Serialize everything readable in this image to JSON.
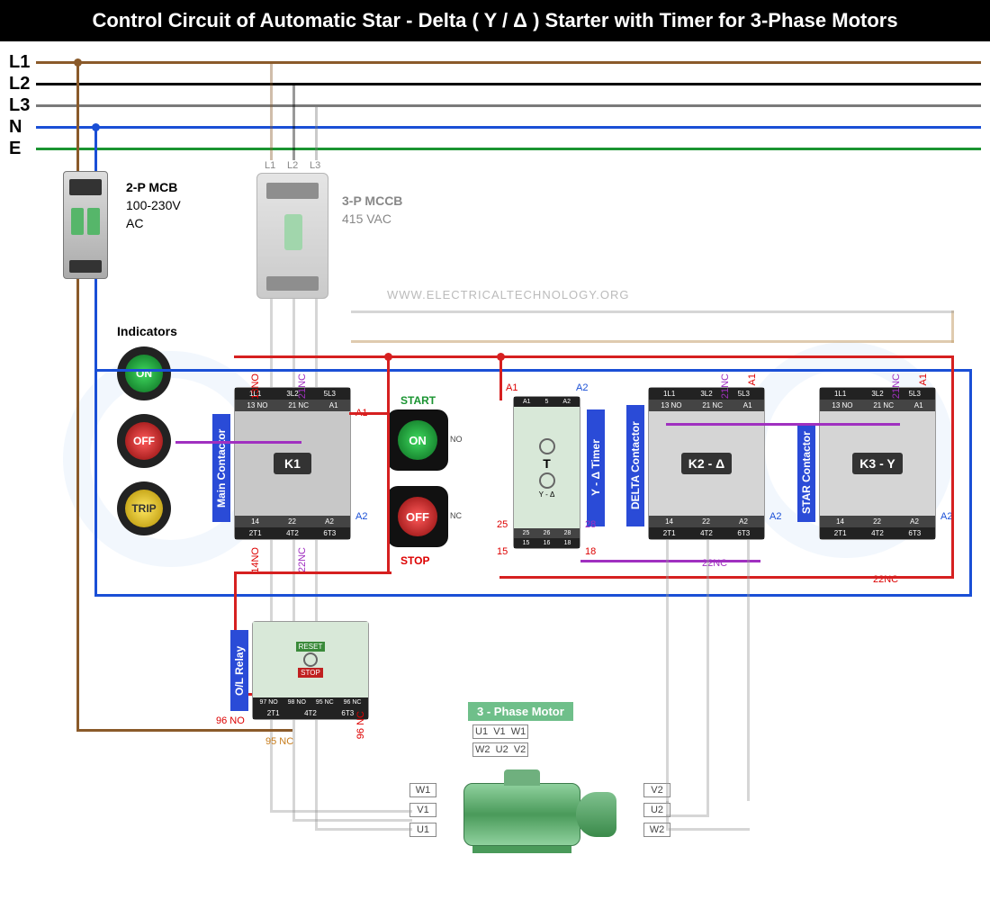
{
  "title": "Control Circuit of Automatic Star - Delta ( Y / Δ ) Starter with Timer for 3-Phase Motors",
  "website": "WWW.ELECTRICALTECHNOLOGY.ORG",
  "bus": {
    "L1": {
      "label": "L1",
      "color": "#8a5a2a"
    },
    "L2": {
      "label": "L2",
      "color": "#000000"
    },
    "L3": {
      "label": "L3",
      "color": "#7a7a7a"
    },
    "N": {
      "label": "N",
      "color": "#1a4fd6"
    },
    "E": {
      "label": "E",
      "color": "#1a9431"
    }
  },
  "mcb": {
    "label": "2-P MCB",
    "voltage": "100-230V",
    "type": "AC"
  },
  "mccb": {
    "label": "3-P MCCB",
    "voltage": "415 VAC",
    "terms": [
      "L1",
      "L2",
      "L3"
    ]
  },
  "indicators": {
    "heading": "Indicators",
    "on": {
      "label": "ON",
      "color": "#1a9431"
    },
    "off": {
      "label": "OFF",
      "color": "#d62020"
    },
    "trip": {
      "label": "TRIP",
      "color": "#e8c820"
    }
  },
  "pushbuttons": {
    "start": {
      "label": "ON",
      "heading": "START",
      "color": "#1a9431"
    },
    "stop": {
      "label": "OFF",
      "heading": "STOP",
      "color": "#d62020"
    }
  },
  "contactors": {
    "main": {
      "name": "K1",
      "label": "Main Contactor",
      "top": [
        "1L1",
        "3L2",
        "5L3"
      ],
      "aux_top": [
        "13 NO",
        "21 NC",
        "A1"
      ],
      "aux_bot": [
        "14",
        "14 NO",
        "22",
        "22 NC",
        "A2"
      ],
      "bot": [
        "2T1",
        "4T2",
        "6T3"
      ]
    },
    "delta": {
      "name": "K2 - Δ",
      "label": "DELTA Contactor",
      "top": [
        "1L1",
        "3L2",
        "5L3"
      ],
      "aux_top": [
        "13 NO",
        "21 NC",
        "A1"
      ],
      "aux_bot": [
        "14",
        "22",
        "A2"
      ],
      "bot": [
        "2T1",
        "4T2",
        "6T3"
      ]
    },
    "star": {
      "name": "K3 - Y",
      "label": "STAR Contactor",
      "top": [
        "1L1",
        "3L2",
        "5L3"
      ],
      "aux_top": [
        "13 NO",
        "21 NC",
        "A1"
      ],
      "aux_bot": [
        "14",
        "22",
        "A2"
      ],
      "bot": [
        "2T1",
        "4T2",
        "6T3"
      ]
    }
  },
  "timer": {
    "label": "Y - Δ Timer",
    "body": "T",
    "sub": "Y - Δ",
    "top": [
      "A1",
      "5",
      "A2"
    ],
    "mid": [
      "25",
      "26",
      "28"
    ],
    "bot": [
      "15",
      "15",
      "16",
      "18"
    ]
  },
  "overload": {
    "label": "O/L Relay",
    "top": [
      "97 NO",
      "98 NO",
      "95 NC",
      "96 NC"
    ],
    "bot": [
      "2T1",
      "4T2",
      "6T3"
    ],
    "reset": "RESET",
    "stop": "STOP"
  },
  "motor": {
    "label": "3 - Phase Motor",
    "top": [
      "U1",
      "V1",
      "W1"
    ],
    "bot": [
      "W2",
      "U2",
      "V2"
    ],
    "left": [
      "W1",
      "V1",
      "U1"
    ],
    "right": [
      "V2",
      "U2",
      "W2"
    ]
  },
  "contact_labels": {
    "13NO": "13NO",
    "21NC": "21NC",
    "14NO": "14NO",
    "22NC": "22NC",
    "A1": "A1",
    "A2": "A2",
    "25": "25",
    "15": "15",
    "18": "18",
    "28": "28",
    "96NO": "96 NO",
    "96NC": "96 NC",
    "95NC": "95 NC"
  }
}
